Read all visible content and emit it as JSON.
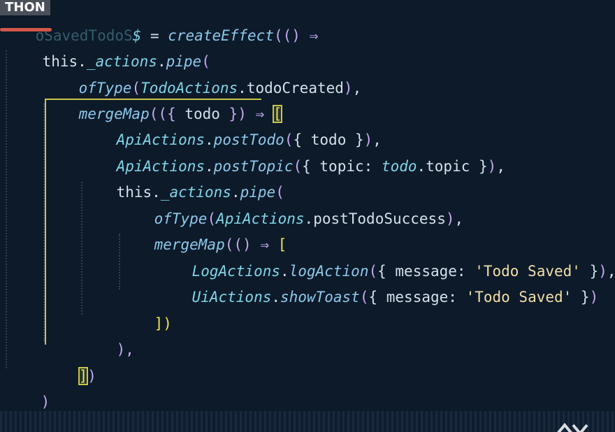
{
  "branding": {
    "badge_text": "THON"
  },
  "editor": {
    "lines": [
      {
        "id": "l1",
        "tokens": [
          "oSavedTodoS",
          "$",
          " = ",
          "createEffect",
          "(",
          "()",
          " ⇒"
        ]
      },
      {
        "id": "l2",
        "tokens": [
          "this",
          ".",
          "_actions",
          ".",
          "pipe",
          "("
        ]
      },
      {
        "id": "l3",
        "tokens": [
          "ofType",
          "(",
          "TodoActions",
          ".",
          "todoCreated",
          ")",
          ","
        ]
      },
      {
        "id": "l4",
        "tokens": [
          "mergeMap",
          "(",
          "({",
          " todo ",
          "})",
          " ⇒ ",
          "["
        ]
      },
      {
        "id": "l5",
        "tokens": [
          "ApiActions",
          ".",
          "postTodo",
          "(",
          "{ todo }",
          ")",
          ","
        ]
      },
      {
        "id": "l6",
        "tokens": [
          "ApiActions",
          ".",
          "postTopic",
          "(",
          "{ topic: ",
          "todo",
          ".topic }",
          ")",
          ","
        ]
      },
      {
        "id": "l7",
        "tokens": [
          "this",
          ".",
          "_actions",
          ".",
          "pipe",
          "("
        ]
      },
      {
        "id": "l8",
        "tokens": [
          "ofType",
          "(",
          "ApiActions",
          ".",
          "postTodoSuccess",
          ")",
          ","
        ]
      },
      {
        "id": "l9",
        "tokens": [
          "mergeMap",
          "(",
          "()",
          " ⇒ ",
          "["
        ]
      },
      {
        "id": "l10",
        "tokens": [
          "LogActions",
          ".",
          "logAction",
          "(",
          "{ message: ",
          "'Todo Saved'",
          " }",
          ")",
          ","
        ]
      },
      {
        "id": "l11",
        "tokens": [
          "UiActions",
          ".",
          "showToast",
          "(",
          "{ message: ",
          "'Todo Saved'",
          " }",
          ")"
        ]
      },
      {
        "id": "l12",
        "tokens": [
          "])"
        ]
      },
      {
        "id": "l13",
        "tokens": [
          "),"
        ]
      },
      {
        "id": "l14",
        "tokens": [
          "]",
          ")"
        ]
      },
      {
        "id": "l15",
        "tokens": [
          ")"
        ]
      }
    ]
  },
  "colors": {
    "background": "#0c1a2a",
    "keyword_italic": "#7fd6e8",
    "string": "#f3dfa6",
    "bracket_highlight": "#f4e54a",
    "paren": "#c9a9f0",
    "guide": "#c9c64a",
    "badge_bg": "#4a505a",
    "underline_red": "#d2574a"
  }
}
